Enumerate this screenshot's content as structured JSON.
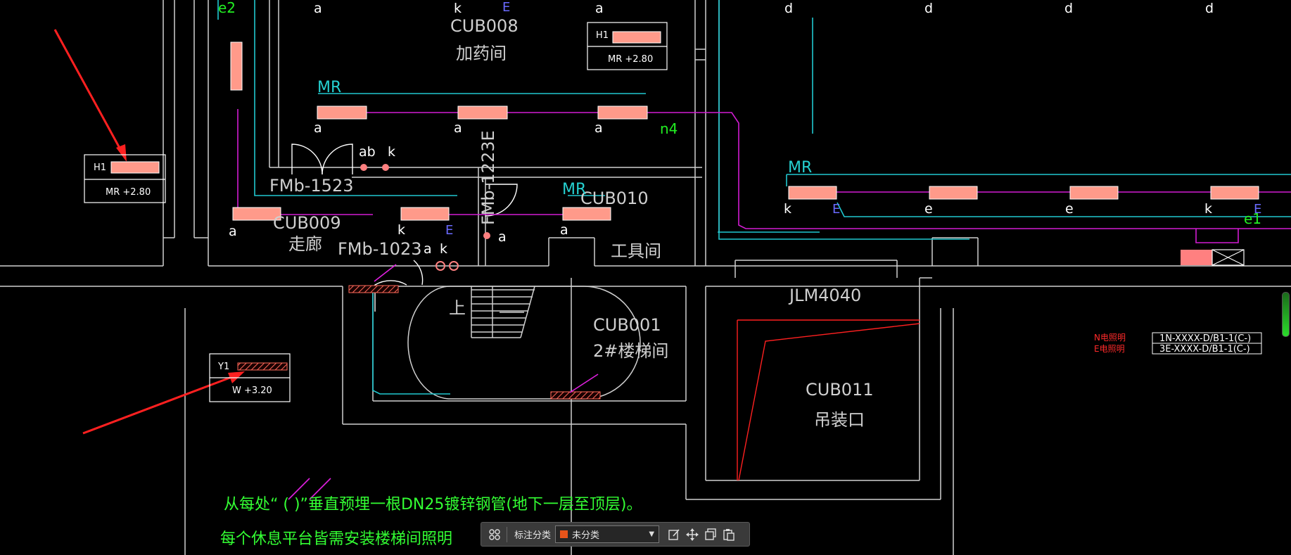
{
  "drawing": {
    "rooms": {
      "cub008": {
        "code": "CUB008",
        "name": "加药间"
      },
      "cub009": {
        "code": "CUB009",
        "name": "走廊"
      },
      "cub010": {
        "code": "CUB010",
        "name": "工具间"
      },
      "cub001": {
        "code": "CUB001",
        "name": "2#楼梯间"
      },
      "cub011": {
        "code": "CUB011",
        "name": "吊装口"
      },
      "jlm": {
        "code": "JLM4040"
      }
    },
    "doors": {
      "d1": "FMb-1523",
      "d2": "FMb-1023",
      "d3": "FMb-1223E"
    },
    "stair_up": "上",
    "mr_labels": [
      "MR",
      "MR",
      "MR"
    ],
    "circuit_labels": {
      "e2": "e2",
      "n4": "n4",
      "e1": "e1",
      "a": "a",
      "k": "k",
      "E": "E",
      "d": "d",
      "e": "e",
      "ab": "ab"
    },
    "legend": {
      "h1_box": {
        "tag": "H1",
        "elev": "MR +2.80"
      },
      "h1_box2": {
        "tag": "H1",
        "elev": "MR +2.80"
      },
      "y1_box": {
        "tag": "Y1",
        "elev": "W +3.20"
      }
    },
    "panel": {
      "n_label": "N电照明",
      "e_label": "E电照明",
      "line1": "1N-XXXX-D/B1-1(C-)",
      "line2": "3E-XXXX-D/B1-1(C-)"
    },
    "notes": {
      "line1": "从每处“  (    )”垂直预埋一根DN25镀锌钢管(地下一层至顶层)。",
      "line2": "每个休息平台皆需安装楼梯间照明"
    },
    "colors": {
      "annotation_arrow": "#ff2020",
      "cable_tray": "#d21cd2",
      "conduit": "#20c8d0",
      "swatch": "#e8541a"
    }
  },
  "toolbar": {
    "grid_icon": "grid-icon",
    "label": "标注分类",
    "select_value": "未分类",
    "icons": [
      "edit-icon",
      "move-icon",
      "copy-icon",
      "paste-icon"
    ]
  }
}
